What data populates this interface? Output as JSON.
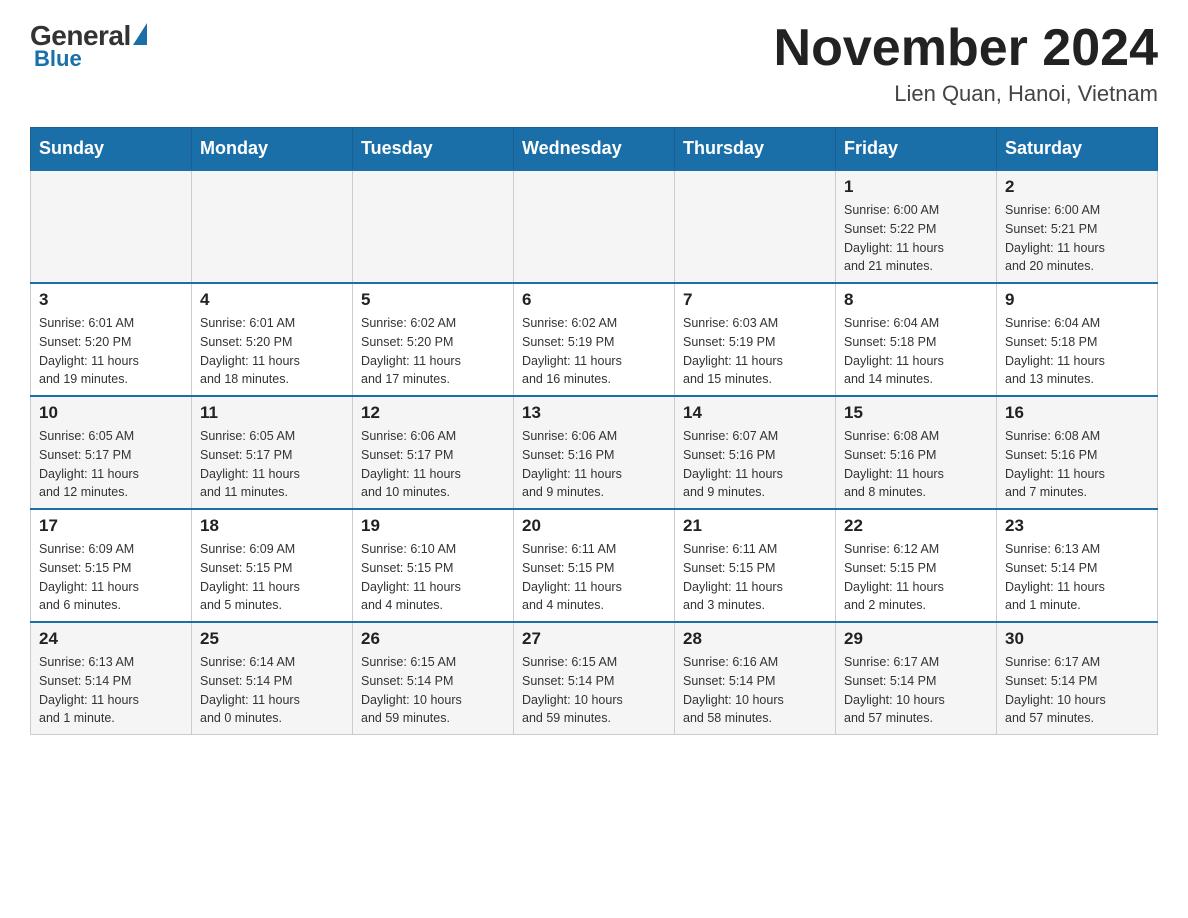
{
  "header": {
    "logo": {
      "general": "General",
      "blue": "Blue"
    },
    "title": "November 2024",
    "location": "Lien Quan, Hanoi, Vietnam"
  },
  "weekdays": [
    "Sunday",
    "Monday",
    "Tuesday",
    "Wednesday",
    "Thursday",
    "Friday",
    "Saturday"
  ],
  "weeks": [
    [
      {
        "day": "",
        "info": ""
      },
      {
        "day": "",
        "info": ""
      },
      {
        "day": "",
        "info": ""
      },
      {
        "day": "",
        "info": ""
      },
      {
        "day": "",
        "info": ""
      },
      {
        "day": "1",
        "info": "Sunrise: 6:00 AM\nSunset: 5:22 PM\nDaylight: 11 hours\nand 21 minutes."
      },
      {
        "day": "2",
        "info": "Sunrise: 6:00 AM\nSunset: 5:21 PM\nDaylight: 11 hours\nand 20 minutes."
      }
    ],
    [
      {
        "day": "3",
        "info": "Sunrise: 6:01 AM\nSunset: 5:20 PM\nDaylight: 11 hours\nand 19 minutes."
      },
      {
        "day": "4",
        "info": "Sunrise: 6:01 AM\nSunset: 5:20 PM\nDaylight: 11 hours\nand 18 minutes."
      },
      {
        "day": "5",
        "info": "Sunrise: 6:02 AM\nSunset: 5:20 PM\nDaylight: 11 hours\nand 17 minutes."
      },
      {
        "day": "6",
        "info": "Sunrise: 6:02 AM\nSunset: 5:19 PM\nDaylight: 11 hours\nand 16 minutes."
      },
      {
        "day": "7",
        "info": "Sunrise: 6:03 AM\nSunset: 5:19 PM\nDaylight: 11 hours\nand 15 minutes."
      },
      {
        "day": "8",
        "info": "Sunrise: 6:04 AM\nSunset: 5:18 PM\nDaylight: 11 hours\nand 14 minutes."
      },
      {
        "day": "9",
        "info": "Sunrise: 6:04 AM\nSunset: 5:18 PM\nDaylight: 11 hours\nand 13 minutes."
      }
    ],
    [
      {
        "day": "10",
        "info": "Sunrise: 6:05 AM\nSunset: 5:17 PM\nDaylight: 11 hours\nand 12 minutes."
      },
      {
        "day": "11",
        "info": "Sunrise: 6:05 AM\nSunset: 5:17 PM\nDaylight: 11 hours\nand 11 minutes."
      },
      {
        "day": "12",
        "info": "Sunrise: 6:06 AM\nSunset: 5:17 PM\nDaylight: 11 hours\nand 10 minutes."
      },
      {
        "day": "13",
        "info": "Sunrise: 6:06 AM\nSunset: 5:16 PM\nDaylight: 11 hours\nand 9 minutes."
      },
      {
        "day": "14",
        "info": "Sunrise: 6:07 AM\nSunset: 5:16 PM\nDaylight: 11 hours\nand 9 minutes."
      },
      {
        "day": "15",
        "info": "Sunrise: 6:08 AM\nSunset: 5:16 PM\nDaylight: 11 hours\nand 8 minutes."
      },
      {
        "day": "16",
        "info": "Sunrise: 6:08 AM\nSunset: 5:16 PM\nDaylight: 11 hours\nand 7 minutes."
      }
    ],
    [
      {
        "day": "17",
        "info": "Sunrise: 6:09 AM\nSunset: 5:15 PM\nDaylight: 11 hours\nand 6 minutes."
      },
      {
        "day": "18",
        "info": "Sunrise: 6:09 AM\nSunset: 5:15 PM\nDaylight: 11 hours\nand 5 minutes."
      },
      {
        "day": "19",
        "info": "Sunrise: 6:10 AM\nSunset: 5:15 PM\nDaylight: 11 hours\nand 4 minutes."
      },
      {
        "day": "20",
        "info": "Sunrise: 6:11 AM\nSunset: 5:15 PM\nDaylight: 11 hours\nand 4 minutes."
      },
      {
        "day": "21",
        "info": "Sunrise: 6:11 AM\nSunset: 5:15 PM\nDaylight: 11 hours\nand 3 minutes."
      },
      {
        "day": "22",
        "info": "Sunrise: 6:12 AM\nSunset: 5:15 PM\nDaylight: 11 hours\nand 2 minutes."
      },
      {
        "day": "23",
        "info": "Sunrise: 6:13 AM\nSunset: 5:14 PM\nDaylight: 11 hours\nand 1 minute."
      }
    ],
    [
      {
        "day": "24",
        "info": "Sunrise: 6:13 AM\nSunset: 5:14 PM\nDaylight: 11 hours\nand 1 minute."
      },
      {
        "day": "25",
        "info": "Sunrise: 6:14 AM\nSunset: 5:14 PM\nDaylight: 11 hours\nand 0 minutes."
      },
      {
        "day": "26",
        "info": "Sunrise: 6:15 AM\nSunset: 5:14 PM\nDaylight: 10 hours\nand 59 minutes."
      },
      {
        "day": "27",
        "info": "Sunrise: 6:15 AM\nSunset: 5:14 PM\nDaylight: 10 hours\nand 59 minutes."
      },
      {
        "day": "28",
        "info": "Sunrise: 6:16 AM\nSunset: 5:14 PM\nDaylight: 10 hours\nand 58 minutes."
      },
      {
        "day": "29",
        "info": "Sunrise: 6:17 AM\nSunset: 5:14 PM\nDaylight: 10 hours\nand 57 minutes."
      },
      {
        "day": "30",
        "info": "Sunrise: 6:17 AM\nSunset: 5:14 PM\nDaylight: 10 hours\nand 57 minutes."
      }
    ]
  ]
}
